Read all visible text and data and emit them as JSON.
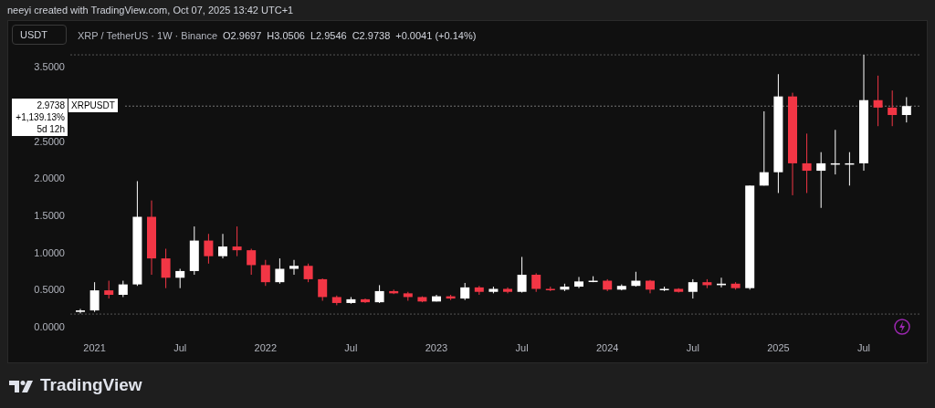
{
  "header": {
    "text": "neeyi created with TradingView.com, Oct 07, 2025 13:42 UTC+1"
  },
  "chart": {
    "currency": "USDT",
    "symbol_line": "XRP / TetherUS · 1W · Binance",
    "ohlc": [
      {
        "key": "O",
        "value": "2.9697"
      },
      {
        "key": "H",
        "value": "3.0506"
      },
      {
        "key": "L",
        "value": "2.9546"
      },
      {
        "key": "C",
        "value": "2.9738"
      }
    ],
    "change": "+0.0041 (+0.14%)",
    "price_label": {
      "price": "2.9738",
      "percent": "+1,139.13%",
      "countdown": "5d 12h",
      "ticker": "XRPUSDT"
    },
    "chart_data": {
      "type": "candlestick",
      "categories": [
        null,
        "2021",
        null,
        null,
        null,
        null,
        null,
        "Jul",
        null,
        null,
        null,
        null,
        null,
        "2022",
        null,
        null,
        null,
        null,
        null,
        "Jul",
        null,
        null,
        null,
        null,
        null,
        "2023",
        null,
        null,
        null,
        null,
        null,
        "Jul",
        null,
        null,
        null,
        null,
        null,
        "2024",
        null,
        null,
        null,
        null,
        null,
        "Jul",
        null,
        null,
        null,
        null,
        null,
        "2025",
        null,
        null,
        null,
        null,
        null,
        "Jul",
        null,
        null,
        null
      ],
      "ohlc": [
        [
          0.2,
          0.24,
          0.18,
          0.22
        ],
        [
          0.22,
          0.6,
          0.2,
          0.49
        ],
        [
          0.49,
          0.62,
          0.38,
          0.43
        ],
        [
          0.43,
          0.62,
          0.4,
          0.57
        ],
        [
          0.57,
          1.96,
          0.55,
          1.48
        ],
        [
          1.48,
          1.7,
          0.7,
          0.92
        ],
        [
          0.92,
          1.05,
          0.52,
          0.66
        ],
        [
          0.66,
          0.78,
          0.52,
          0.75
        ],
        [
          0.75,
          1.35,
          0.7,
          1.16
        ],
        [
          1.16,
          1.25,
          0.85,
          0.95
        ],
        [
          0.95,
          1.25,
          0.92,
          1.08
        ],
        [
          1.08,
          1.35,
          0.95,
          1.03
        ],
        [
          1.03,
          1.05,
          0.7,
          0.83
        ],
        [
          0.83,
          0.9,
          0.55,
          0.6
        ],
        [
          0.6,
          0.92,
          0.58,
          0.78
        ],
        [
          0.78,
          0.9,
          0.7,
          0.82
        ],
        [
          0.82,
          0.85,
          0.6,
          0.64
        ],
        [
          0.64,
          0.65,
          0.35,
          0.4
        ],
        [
          0.4,
          0.42,
          0.29,
          0.32
        ],
        [
          0.32,
          0.4,
          0.31,
          0.37
        ],
        [
          0.37,
          0.38,
          0.32,
          0.33
        ],
        [
          0.33,
          0.56,
          0.32,
          0.48
        ],
        [
          0.48,
          0.5,
          0.44,
          0.45
        ],
        [
          0.45,
          0.47,
          0.35,
          0.4
        ],
        [
          0.4,
          0.41,
          0.33,
          0.34
        ],
        [
          0.34,
          0.43,
          0.34,
          0.41
        ],
        [
          0.41,
          0.43,
          0.36,
          0.38
        ],
        [
          0.38,
          0.59,
          0.36,
          0.53
        ],
        [
          0.53,
          0.55,
          0.43,
          0.47
        ],
        [
          0.47,
          0.54,
          0.45,
          0.51
        ],
        [
          0.51,
          0.53,
          0.45,
          0.47
        ],
        [
          0.47,
          0.94,
          0.46,
          0.7
        ],
        [
          0.7,
          0.72,
          0.47,
          0.51
        ],
        [
          0.51,
          0.54,
          0.48,
          0.5
        ],
        [
          0.5,
          0.58,
          0.48,
          0.54
        ],
        [
          0.54,
          0.67,
          0.52,
          0.61
        ],
        [
          0.61,
          0.68,
          0.6,
          0.62
        ],
        [
          0.62,
          0.64,
          0.48,
          0.5
        ],
        [
          0.5,
          0.57,
          0.49,
          0.55
        ],
        [
          0.55,
          0.74,
          0.54,
          0.62
        ],
        [
          0.62,
          0.63,
          0.45,
          0.5
        ],
        [
          0.5,
          0.54,
          0.48,
          0.51
        ],
        [
          0.51,
          0.52,
          0.46,
          0.47
        ],
        [
          0.47,
          0.64,
          0.38,
          0.6
        ],
        [
          0.6,
          0.64,
          0.52,
          0.56
        ],
        [
          0.56,
          0.66,
          0.53,
          0.58
        ],
        [
          0.58,
          0.6,
          0.5,
          0.52
        ],
        [
          0.52,
          1.9,
          0.5,
          1.9
        ],
        [
          1.9,
          2.9,
          1.9,
          2.08
        ],
        [
          2.08,
          3.4,
          1.8,
          3.1
        ],
        [
          3.1,
          3.15,
          1.77,
          2.2
        ],
        [
          2.2,
          2.6,
          1.8,
          2.1
        ],
        [
          2.1,
          2.35,
          1.6,
          2.2
        ],
        [
          2.2,
          2.65,
          2.05,
          2.2
        ],
        [
          2.2,
          2.35,
          1.9,
          2.2
        ],
        [
          2.2,
          3.66,
          2.1,
          3.05
        ],
        [
          3.05,
          3.38,
          2.7,
          2.95
        ],
        [
          2.95,
          3.18,
          2.7,
          2.85
        ],
        [
          2.85,
          3.09,
          2.75,
          2.97
        ]
      ],
      "ylim": [
        0,
        3.5
      ],
      "yticks": [
        {
          "value": 0,
          "label": "0.0000"
        },
        {
          "value": 0.5,
          "label": "0.5000"
        },
        {
          "value": 1,
          "label": "1.0000"
        },
        {
          "value": 1.5,
          "label": "1.5000"
        },
        {
          "value": 2,
          "label": "2.0000"
        },
        {
          "value": 2.5,
          "label": "2.5000"
        },
        {
          "value": 3.5,
          "label": "3.5000"
        }
      ]
    }
  },
  "footer": {
    "brand": "TradingView"
  }
}
